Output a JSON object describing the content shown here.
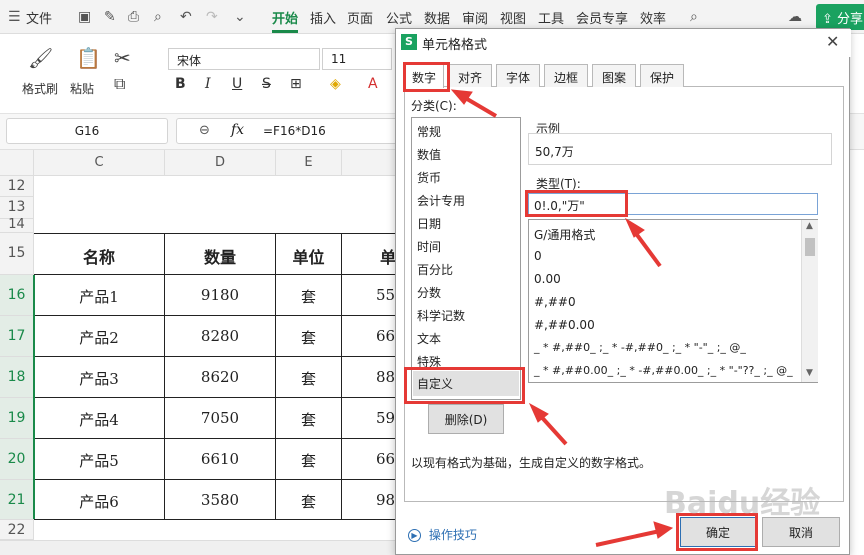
{
  "menubar": {
    "file_label": "文件",
    "items": [
      "开始",
      "插入",
      "页面",
      "公式",
      "数据",
      "审阅",
      "视图",
      "工具",
      "会员专享",
      "效率"
    ],
    "share_label": "分享"
  },
  "ribbon": {
    "format_painter": "格式刷",
    "paste": "粘贴",
    "font_name": "宋体",
    "font_size": "11",
    "bold": "B",
    "italic": "I",
    "underline": "U"
  },
  "formula_bar": {
    "name_box": "G16",
    "formula": "=F16*D16"
  },
  "sheet": {
    "columns": [
      "C",
      "D",
      "E"
    ],
    "rows": [
      "12",
      "13",
      "14",
      "15",
      "16",
      "17",
      "18",
      "19",
      "20",
      "21",
      "22"
    ],
    "header": [
      "名称",
      "数量",
      "单位",
      "单"
    ],
    "data": [
      [
        "产品1",
        "9180",
        "套",
        "55"
      ],
      [
        "产品2",
        "8280",
        "套",
        "66"
      ],
      [
        "产品3",
        "8620",
        "套",
        "88"
      ],
      [
        "产品4",
        "7050",
        "套",
        "59"
      ],
      [
        "产品5",
        "6610",
        "套",
        "66"
      ],
      [
        "产品6",
        "3580",
        "套",
        "98"
      ]
    ]
  },
  "dialog": {
    "title": "单元格格式",
    "tabs": [
      "数字",
      "对齐",
      "字体",
      "边框",
      "图案",
      "保护"
    ],
    "category_label": "分类(C):",
    "categories": [
      "常规",
      "数值",
      "货币",
      "会计专用",
      "日期",
      "时间",
      "百分比",
      "分数",
      "科学记数",
      "文本",
      "特殊",
      "自定义"
    ],
    "sample_label": "示例",
    "sample_value": "50,7万",
    "type_label": "类型(T):",
    "type_value": "0!.0,\"万\"",
    "type_options": [
      "G/通用格式",
      "0",
      "0.00",
      "#,##0",
      "#,##0.00",
      "_ * #,##0_ ;_ * -#,##0_ ;_ * \"-\"_ ;_ @_",
      "_ * #,##0.00_ ;_ * -#,##0.00_ ;_ * \"-\"??_ ;_ @_"
    ],
    "delete_button": "删除(D)",
    "description": "以现有格式为基础，生成自定义的数字格式。",
    "tips_link": "操作技巧",
    "ok_button": "确定",
    "cancel_button": "取消"
  },
  "watermark": "Baidu经验"
}
